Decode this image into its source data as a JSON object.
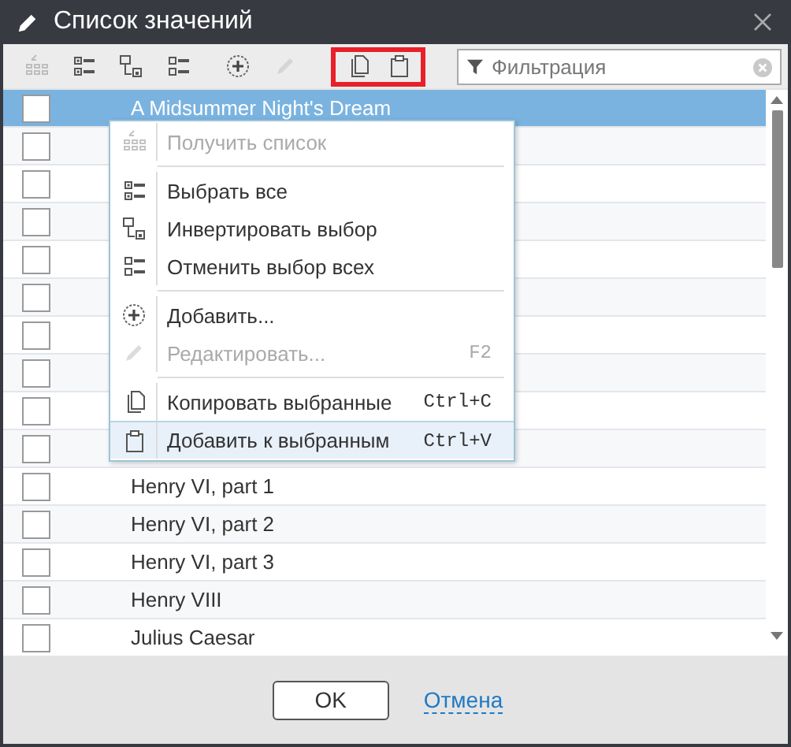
{
  "window": {
    "title": "Список значений"
  },
  "toolbar": [
    {
      "kind": "list",
      "disabled": true,
      "highlighted": false
    },
    {
      "kind": "checklist",
      "disabled": false,
      "highlighted": false
    },
    {
      "kind": "invert",
      "disabled": false,
      "highlighted": false
    },
    {
      "kind": "uncheck",
      "disabled": false,
      "highlighted": false
    },
    {
      "kind": "add",
      "disabled": false,
      "highlighted": false
    },
    {
      "kind": "edit",
      "disabled": true,
      "highlighted": false
    },
    {
      "kind": "copy",
      "disabled": false,
      "highlighted": true
    },
    {
      "kind": "paste",
      "disabled": false,
      "highlighted": true
    }
  ],
  "filter": {
    "placeholder": "Фильтрация"
  },
  "rows": [
    {
      "label": "A Midsummer Night's Dream",
      "checked": false,
      "selected": true
    },
    {
      "checked": false,
      "selected": false
    },
    {
      "checked": false,
      "selected": false
    },
    {
      "checked": false,
      "selected": false
    },
    {
      "checked": false,
      "selected": false
    },
    {
      "checked": false,
      "selected": false
    },
    {
      "checked": false,
      "selected": false
    },
    {
      "checked": false,
      "selected": false
    },
    {
      "checked": false,
      "selected": false
    },
    {
      "checked": false,
      "selected": false
    },
    {
      "label": "Henry VI, part 1",
      "checked": false,
      "selected": false
    },
    {
      "label": "Henry VI, part 2",
      "checked": false,
      "selected": false
    },
    {
      "label": "Henry VI, part 3",
      "checked": false,
      "selected": false
    },
    {
      "label": "Henry VIII",
      "checked": false,
      "selected": false
    },
    {
      "label": "Julius Caesar",
      "checked": false,
      "selected": false
    }
  ],
  "context_menu": [
    {
      "kind": "list",
      "label": "Получить список",
      "disabled": true,
      "selected": false
    },
    {
      "kind": "separator"
    },
    {
      "kind": "checklist",
      "label": "Выбрать все",
      "disabled": false,
      "selected": false
    },
    {
      "kind": "invert",
      "label": "Инвертировать выбор",
      "disabled": false,
      "selected": false
    },
    {
      "kind": "uncheck",
      "label": "Отменить выбор всех",
      "disabled": false,
      "selected": false
    },
    {
      "kind": "separator"
    },
    {
      "kind": "add",
      "label": "Добавить...",
      "disabled": false,
      "selected": false
    },
    {
      "kind": "edit",
      "label": "Редактировать...",
      "shortcut": "F2",
      "disabled": true,
      "selected": false
    },
    {
      "kind": "separator"
    },
    {
      "kind": "copy",
      "label": "Копировать выбранные",
      "shortcut": "Ctrl+C",
      "disabled": false,
      "selected": false
    },
    {
      "kind": "paste",
      "label": "Добавить к выбранным",
      "shortcut": "Ctrl+V",
      "disabled": false,
      "selected": true
    }
  ],
  "buttons": [
    {
      "kind": "button",
      "label": "OK"
    },
    {
      "kind": "link",
      "label": "Отмена"
    }
  ]
}
